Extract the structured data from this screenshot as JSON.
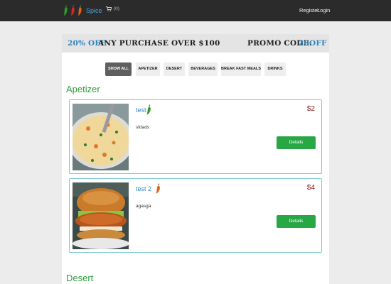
{
  "navbar": {
    "brand_name": "Spice",
    "brand_icon": "chili-pepper-icon",
    "cart_icon": "shopping-cart-icon",
    "cart_count": "(0)",
    "register_label": "Register",
    "login_label": "Login"
  },
  "promo": {
    "percent": "20% OFF",
    "text": "ANY PURCHASE OVER $100",
    "code_label": "PROMO CODE:",
    "code": "20OFF"
  },
  "filters": [
    "SHOW ALL",
    "APETIZER",
    "DESERT",
    "BEVERAGES",
    "BREAK FAST MEALS",
    "DRINKS"
  ],
  "active_filter": "SHOW ALL",
  "sections": [
    {
      "title": "Apetizer",
      "items": [
        {
          "name": "test",
          "description": "sfdads",
          "price": "$2",
          "spice_icon": "green-chili-icon",
          "image": "soup-bowl",
          "button": "Details"
        },
        {
          "name": "test 2",
          "description": "agasga",
          "price": "$4",
          "spice_icon": "orange-chili-icon",
          "image": "chicken-burger",
          "button": "Details"
        }
      ]
    },
    {
      "title": "Desert",
      "items": []
    }
  ],
  "colors": {
    "navbar_bg": "#2b2b2b",
    "accent_blue": "#2e86c1",
    "section_green": "#2e9c3e",
    "price_red": "#8b1a1a",
    "button_green": "#28a745",
    "card_border": "#7ec9d8"
  }
}
